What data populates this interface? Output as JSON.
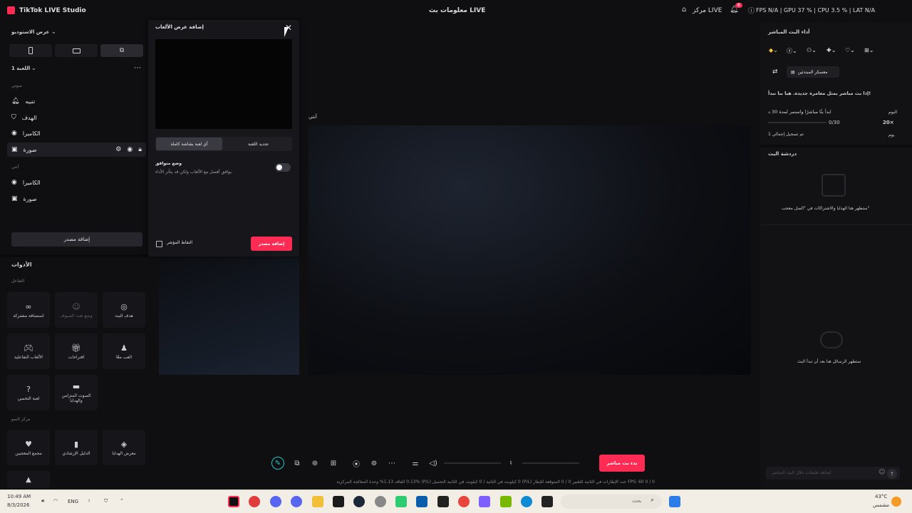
{
  "app": {
    "title": "TikTok LIVE Studio",
    "live_info": "معلومات بث LIVE"
  },
  "titlebar": {
    "live_center": "مركز LIVE",
    "notif_count": "8",
    "stats": "FPS N/A  |  GPU 37 %  |  CPU 3.5 %  |  LAT N/A"
  },
  "left": {
    "studio_view": "عرض الاستوديو",
    "scene": "اللعبة 1",
    "section_audio": "صوتي",
    "items_a": [
      "تنبيه",
      "الهدف",
      "الكاميرا",
      "صورة"
    ],
    "section_mine": "أنتي",
    "items_b": [
      "الكاميرا",
      "صورة"
    ],
    "add_source": "إضافة مصدر",
    "tools_title": "الأدوات",
    "section_interact": "التفاعل",
    "tools": [
      {
        "icon": "link-icon",
        "label": "استضافة مشتركة"
      },
      {
        "icon": "multi-guest-icon",
        "label": "وضع تعدد الضيوف"
      },
      {
        "icon": "target-icon",
        "label": "هدف البث"
      },
      {
        "icon": "gamepad-icon",
        "label": "الألعاب التفاعلية"
      },
      {
        "icon": "gift-icon",
        "label": "اقتراحات"
      },
      {
        "icon": "user-play-icon",
        "label": "العب معًا"
      },
      {
        "icon": "question-icon",
        "label": "لعبة التخمين"
      },
      {
        "icon": "voice-gift-icon",
        "label": "الصوت المتزامن والهدايا"
      }
    ],
    "section_growth": "مركز النمو",
    "tools2": [
      {
        "icon": "heart-icon",
        "label": "مجمع المعجبين"
      },
      {
        "icon": "book-icon",
        "label": "الدليل الإرشادي"
      },
      {
        "icon": "gift-gallery-icon",
        "label": "معرض الهدايا"
      }
    ]
  },
  "modal": {
    "title": "إضافة عرض الألعاب",
    "tab_full": "أي لعبة بشاشة كاملة",
    "tab_select": "تحديد اللعبة",
    "compat_title": "وضع متوافق",
    "compat_desc": "يوافق أفضل مع الألعاب ولكن قد يتأثر الأداء.",
    "cursor_label": "التقاط المؤشر",
    "add_button": "إضافة مصدر"
  },
  "canvas": {
    "label": "أنتي"
  },
  "right": {
    "performance_title": "أداء البث المباشر",
    "beginner_camp": "معسكر المبتدئين",
    "challenge": "إذا بث مباشر بمثل مغامرة جديدة. هيا بنا نبدأ!",
    "day_label": "اليوم",
    "task": "ابدأ بثًا مباشرًا واستمر لمدة 30 د",
    "progress": "0/30",
    "progress_fraction": 0.0,
    "reward": "20×",
    "week_label": "يوم",
    "streak": "تم تسجيل إجمالي 1",
    "chat_title": "دردشة البث",
    "gifts_empty": "ستظهر هنا الهدايا والاشتراكات في \"الضل معجب\"",
    "chat_empty": "ستظهر الرسائل هنا بعد أن تبدأ البث",
    "comment_placeholder": "إضافة تعليقات خلال البث المباشر"
  },
  "bottom": {
    "go_live": "بدء بث مباشر",
    "status": "FPS: 60    0 / 0 عدد الإطارات في الثانية للتغيير    0 / 0 المتوقعة للإطار (P/L)    0 كيلوبت في الثانية / 0 كيلوبت في الثانية   التحميل (P/L)    0.13%   الفاقد    1.13%   وحدة المعالجة المركزية"
  },
  "taskbar": {
    "time": "10:49 AM",
    "date": "8/3/2026",
    "lang": "ENG",
    "search": "بحث",
    "weather_temp": "43°C",
    "weather_desc": "مشمس"
  },
  "colors": {
    "accent": "#fe2c55",
    "teal": "#25c6c4",
    "bg": "#0f0f12"
  }
}
